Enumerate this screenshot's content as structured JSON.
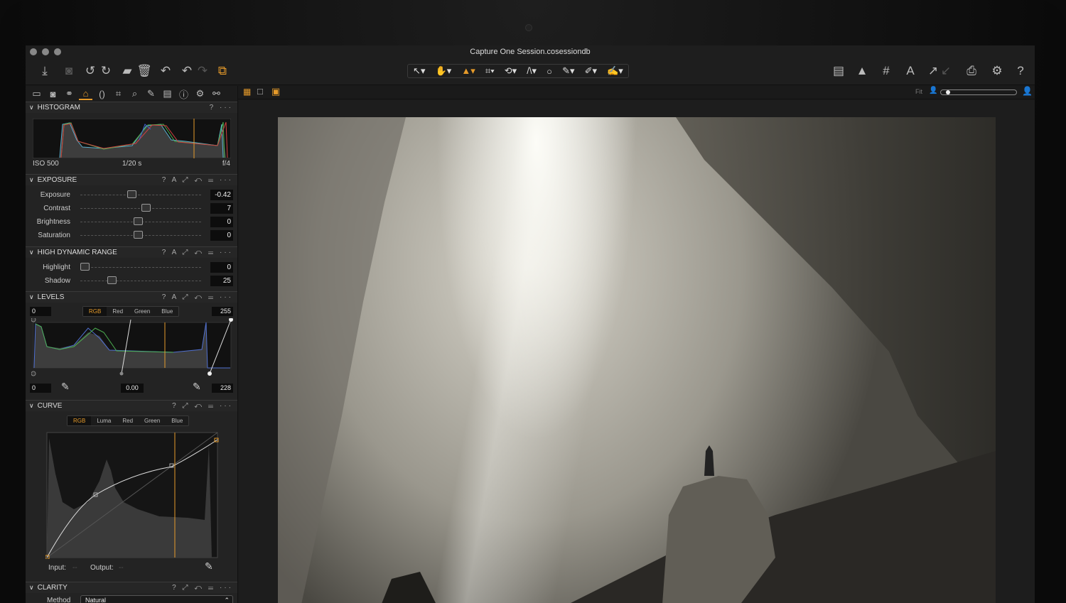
{
  "window": {
    "title": "Capture One Session.cosessiondb"
  },
  "histogram": {
    "title": "HISTOGRAM",
    "iso": "ISO 500",
    "shutter": "1/20 s",
    "aperture": "f/4",
    "actions": "? ···"
  },
  "exposure": {
    "title": "EXPOSURE",
    "actions": "? A ⤢ ↶ ☰ ···",
    "sliders": [
      {
        "label": "Exposure",
        "value": "-0.42",
        "pos": 0.44
      },
      {
        "label": "Contrast",
        "value": "7",
        "pos": 0.57
      },
      {
        "label": "Brightness",
        "value": "0",
        "pos": 0.5
      },
      {
        "label": "Saturation",
        "value": "0",
        "pos": 0.5
      }
    ]
  },
  "hdr": {
    "title": "HIGH DYNAMIC RANGE",
    "actions": "? A ⤢ ↶ ☰ ···",
    "sliders": [
      {
        "label": "Highlight",
        "value": "0",
        "pos": 0.0
      },
      {
        "label": "Shadow",
        "value": "25",
        "pos": 0.25
      }
    ]
  },
  "levels": {
    "title": "LEVELS",
    "actions": "? A ⤢ ↶ ☰ ···",
    "channels": [
      "RGB",
      "Red",
      "Green",
      "Blue"
    ],
    "input_low": "0",
    "input_high": "255",
    "output_low": "0",
    "midpoint": "0.00",
    "output_high": "228"
  },
  "curve": {
    "title": "CURVE",
    "actions": "? ⤢ ↶ ☰ ···",
    "channels": [
      "RGB",
      "Luma",
      "Red",
      "Green",
      "Blue"
    ],
    "input_label": "Input:",
    "input_value": "--",
    "output_label": "Output:",
    "output_value": "--"
  },
  "clarity": {
    "title": "CLARITY",
    "actions": "? ⤢ ↶ ☰ ···",
    "method_label": "Method",
    "method_value": "Natural"
  },
  "viewer": {
    "fit_label": "Fit",
    "zoom_fraction": 0.1
  },
  "colors": {
    "accent": "#e59a2a"
  }
}
